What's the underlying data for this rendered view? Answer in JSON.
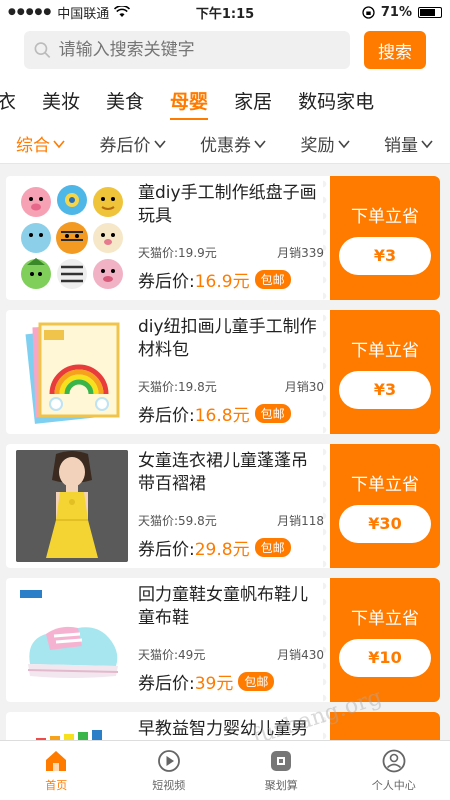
{
  "status_bar": {
    "carrier": "中国联通",
    "time": "下午1:15",
    "battery": "71%"
  },
  "search": {
    "placeholder": "请输入搜索关键字",
    "button_label": "搜索"
  },
  "categories": [
    {
      "label": "内衣",
      "active": false
    },
    {
      "label": "美妆",
      "active": false
    },
    {
      "label": "美食",
      "active": false
    },
    {
      "label": "母婴",
      "active": true
    },
    {
      "label": "家居",
      "active": false
    },
    {
      "label": "数码家电",
      "active": false
    }
  ],
  "sort_tabs": [
    {
      "label": "综合",
      "active": true
    },
    {
      "label": "券后价",
      "active": false
    },
    {
      "label": "优惠券",
      "active": false
    },
    {
      "label": "奖励",
      "active": false
    },
    {
      "label": "销量",
      "active": false
    }
  ],
  "products": [
    {
      "title": "童diy手工制作纸盘子画玩具",
      "tmall_price": "天猫价:19.9元",
      "monthly_sales": "月销339",
      "coupon_price_label": "券后价:",
      "coupon_price": "16.9元",
      "badge": "包邮",
      "cta_label": "下单立省",
      "savings": "¥3"
    },
    {
      "title": "diy纽扣画儿童手工制作材料包",
      "tmall_price": "天猫价:19.8元",
      "monthly_sales": "月销30",
      "coupon_price_label": "券后价:",
      "coupon_price": "16.8元",
      "badge": "包邮",
      "cta_label": "下单立省",
      "savings": "¥3"
    },
    {
      "title": "女童连衣裙儿童蓬蓬吊带百褶裙",
      "tmall_price": "天猫价:59.8元",
      "monthly_sales": "月销118",
      "coupon_price_label": "券后价:",
      "coupon_price": "29.8元",
      "badge": "包邮",
      "cta_label": "下单立省",
      "savings": "¥30"
    },
    {
      "title": "回力童鞋女童帆布鞋儿童布鞋",
      "tmall_price": "天猫价:49元",
      "monthly_sales": "月销430",
      "coupon_price_label": "券后价:",
      "coupon_price": "39元",
      "badge": "包邮",
      "cta_label": "下单立省",
      "savings": "¥10"
    },
    {
      "title": "早教益智力婴幼儿童男",
      "tmall_price": "",
      "monthly_sales": "",
      "coupon_price_label": "",
      "coupon_price": "",
      "badge": "",
      "cta_label": "",
      "savings": ""
    }
  ],
  "tabbar": [
    {
      "label": "首页",
      "icon": "home-icon",
      "active": true
    },
    {
      "label": "短视频",
      "icon": "play-icon",
      "active": false
    },
    {
      "label": "聚划算",
      "icon": "deal-icon",
      "active": false
    },
    {
      "label": "个人中心",
      "icon": "user-icon",
      "active": false
    }
  ],
  "watermark": "fuzhang.org",
  "colors": {
    "accent": "#ff7b00",
    "background": "#f2f2f2"
  }
}
